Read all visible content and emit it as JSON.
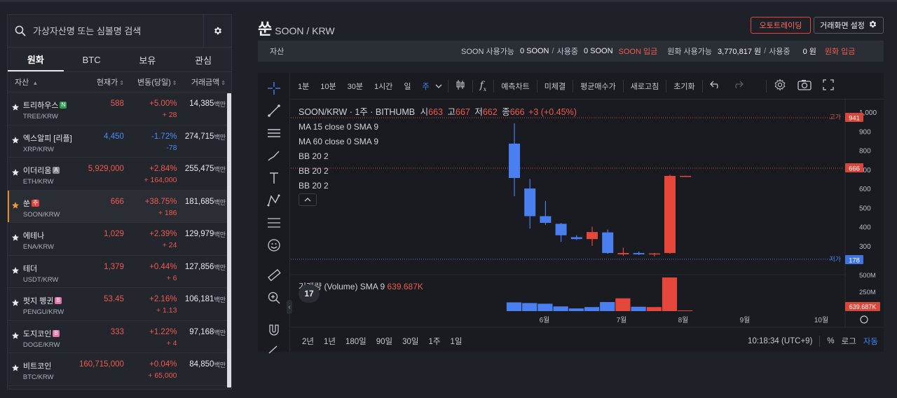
{
  "search": {
    "placeholder": "가상자산명 또는 심볼명 검색"
  },
  "market_tabs": [
    "원화",
    "BTC",
    "보유",
    "관심"
  ],
  "market_headers": {
    "asset": "자산",
    "price": "현재가",
    "change": "변동(당일)",
    "volume": "거래금액"
  },
  "market_rows": [
    {
      "name": "트리하우스",
      "badge": "N",
      "badge_color": "#2e9e53",
      "pair": "TREE/KRW",
      "price": "588",
      "change_pct": "+5.00%",
      "change_abs": "+ 28",
      "volume": "14,385",
      "unit": "백만",
      "dir": "up",
      "starred": false
    },
    {
      "name": "엑스알피 [리플]",
      "badge": "",
      "badge_color": "",
      "pair": "XRP/KRW",
      "price": "4,450",
      "change_pct": "-1.72%",
      "change_abs": "-78",
      "volume": "274,715",
      "unit": "백만",
      "dir": "dn",
      "starred": false
    },
    {
      "name": "이더리움",
      "badge": "A",
      "badge_color": "#8a8f97",
      "pair": "ETH/KRW",
      "price": "5,929,000",
      "change_pct": "+2.84%",
      "change_abs": "+ 164,000",
      "volume": "255,475",
      "unit": "백만",
      "dir": "up",
      "starred": false
    },
    {
      "name": "쑨",
      "badge": "주",
      "badge_color": "#e5483b",
      "pair": "SOON/KRW",
      "price": "666",
      "change_pct": "+38.75%",
      "change_abs": "+ 186",
      "volume": "181,685",
      "unit": "백만",
      "dir": "up",
      "starred": true
    },
    {
      "name": "에테나",
      "badge": "",
      "badge_color": "",
      "pair": "ENA/KRW",
      "price": "1,029",
      "change_pct": "+2.39%",
      "change_abs": "+ 24",
      "volume": "129,979",
      "unit": "백만",
      "dir": "up",
      "starred": false
    },
    {
      "name": "테더",
      "badge": "",
      "badge_color": "",
      "pair": "USDT/KRW",
      "price": "1,379",
      "change_pct": "+0.44%",
      "change_abs": "+ 6",
      "volume": "127,856",
      "unit": "백만",
      "dir": "up",
      "starred": false
    },
    {
      "name": "펏지 펭귄",
      "badge": "B",
      "badge_color": "#e774a6",
      "pair": "PENGU/KRW",
      "price": "53.45",
      "change_pct": "+2.16%",
      "change_abs": "+ 1.13",
      "volume": "106,181",
      "unit": "백만",
      "dir": "up",
      "starred": false
    },
    {
      "name": "도지코인",
      "badge": "B",
      "badge_color": "#e774a6",
      "pair": "DOGE/KRW",
      "price": "333",
      "change_pct": "+1.22%",
      "change_abs": "+ 4",
      "volume": "97,168",
      "unit": "백만",
      "dir": "up",
      "starred": false
    },
    {
      "name": "비트코인",
      "badge": "",
      "badge_color": "",
      "pair": "BTC/KRW",
      "price": "160,715,000",
      "change_pct": "+0.04%",
      "change_abs": "+ 65,000",
      "volume": "84,850",
      "unit": "백만",
      "dir": "up",
      "starred": false
    }
  ],
  "header": {
    "coin_kr": "쑨",
    "coin_en": "SOON / KRW",
    "auto_trade": "오토트레이딩",
    "screen_setting": "거래화면 설정"
  },
  "asset_bar": {
    "label": "자산",
    "coin_avail_label": "SOON 사용가능",
    "coin_avail": "0 SOON",
    "coin_inuse_label": "사용중",
    "coin_inuse": "0 SOON",
    "coin_deposit": "SOON 입금",
    "krw_avail_label": "원화 사용가능",
    "krw_avail": "3,770,817 원",
    "krw_inuse_label": "사용중",
    "krw_inuse": "0 원",
    "krw_deposit": "원화 입금"
  },
  "chart_toolbar": {
    "intervals": [
      "1분",
      "10분",
      "30분",
      "1시간",
      "일",
      "주"
    ],
    "active_interval": "주",
    "indicators_label": "예측차트",
    "unfilled_label": "미체결",
    "avg_price_label": "평균매수가",
    "refresh_label": "새로고침",
    "reset_label": "초기화"
  },
  "chart_legend": {
    "symbol": "SOON/KRW · 1주 · BITHUMB",
    "open_label": "시",
    "open": "663",
    "high_label": "고",
    "high": "667",
    "low_label": "저",
    "low": "662",
    "close_label": "종",
    "close": "666",
    "change": "+3 (+0.45%)",
    "ma1": "MA 15 close 0 SMA 9",
    "ma2": "MA 60 close 0 SMA 9",
    "bb1": "BB 20 2",
    "bb2": "BB 20 2",
    "bb3": "BB 20 2"
  },
  "volume_legend": {
    "label": "거래량 (Volume) SMA 9",
    "value": "639.687K"
  },
  "price_labels": {
    "high_label": "고가",
    "high_value": "941",
    "low_label": "저가",
    "low_value": "178",
    "last_value": "666",
    "vol_value": "639.687K"
  },
  "bottom_bar": {
    "ranges": [
      "2년",
      "1년",
      "180일",
      "90일",
      "30일",
      "1주",
      "1일"
    ],
    "time": "10:18:34 (UTC+9)",
    "percent": "%",
    "log": "로그",
    "auto": "자동"
  },
  "chart_data": {
    "type": "candlestick",
    "title": "SOON/KRW · 1주 · BITHUMB",
    "x_ticks": [
      "6월",
      "7월",
      "8월",
      "9월",
      "10월"
    ],
    "y_ticks": [
      1000,
      900,
      800,
      700,
      600,
      500,
      400,
      300
    ],
    "ylim": [
      200,
      1000
    ],
    "volume_ticks": [
      "500M",
      "250M"
    ],
    "candles": [
      {
        "o": 835,
        "h": 941,
        "l": 560,
        "c": 655,
        "dir": "dn"
      },
      {
        "o": 600,
        "h": 650,
        "l": 390,
        "c": 455,
        "dir": "dn"
      },
      {
        "o": 455,
        "h": 535,
        "l": 410,
        "c": 420,
        "dir": "dn"
      },
      {
        "o": 415,
        "h": 420,
        "l": 320,
        "c": 355,
        "dir": "dn"
      },
      {
        "o": 345,
        "h": 355,
        "l": 330,
        "c": 335,
        "dir": "dn"
      },
      {
        "o": 335,
        "h": 400,
        "l": 300,
        "c": 372,
        "dir": "up"
      },
      {
        "o": 370,
        "h": 385,
        "l": 258,
        "c": 262,
        "dir": "dn"
      },
      {
        "o": 255,
        "h": 290,
        "l": 248,
        "c": 262,
        "dir": "up"
      },
      {
        "o": 262,
        "h": 270,
        "l": 252,
        "c": 255,
        "dir": "dn"
      },
      {
        "o": 255,
        "h": 262,
        "l": 245,
        "c": 260,
        "dir": "up"
      },
      {
        "o": 262,
        "h": 672,
        "l": 258,
        "c": 666,
        "dir": "up"
      },
      {
        "o": 663,
        "h": 667,
        "l": 662,
        "c": 666,
        "dir": "up"
      }
    ],
    "volumes": [
      {
        "v": 0.26,
        "dir": "dn"
      },
      {
        "v": 0.24,
        "dir": "dn"
      },
      {
        "v": 0.22,
        "dir": "dn"
      },
      {
        "v": 0.14,
        "dir": "dn"
      },
      {
        "v": 0.08,
        "dir": "dn"
      },
      {
        "v": 0.12,
        "dir": "dn"
      },
      {
        "v": 0.27,
        "dir": "dn"
      },
      {
        "v": 0.38,
        "dir": "up"
      },
      {
        "v": 0.13,
        "dir": "dn"
      },
      {
        "v": 0.12,
        "dir": "up"
      },
      {
        "v": 1.0,
        "dir": "up"
      },
      {
        "v": 0.01,
        "dir": "up"
      }
    ],
    "colors": {
      "up": "#e5483b",
      "down": "#4a7ff0"
    }
  }
}
